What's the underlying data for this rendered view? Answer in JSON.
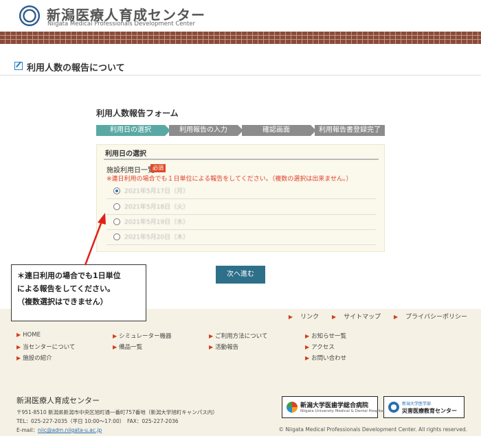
{
  "header": {
    "title": "新潟医療人育成センター",
    "subtitle": "Niigata Medical Professionals Development Center"
  },
  "page": {
    "title": "利用人数の報告について"
  },
  "form": {
    "heading": "利用人数報告フォーム",
    "steps": [
      {
        "label": "利用日の選択",
        "active": true
      },
      {
        "label": "利用報告の入力",
        "active": false
      },
      {
        "label": "確認画面",
        "active": false
      },
      {
        "label": "利用報告書登録完了",
        "active": false
      }
    ],
    "panel_heading": "利用日の選択",
    "field_label": "施設利用日一覧",
    "required_badge": "必須",
    "notice": "※連日利用の場合でも１日単位による報告をしてください。（複数の選択は出来ません。）",
    "options": [
      {
        "label": "2021年5月17日（月）",
        "checked": true
      },
      {
        "label": "2021年5月18日（火）",
        "checked": false
      },
      {
        "label": "2021年5月19日（水）",
        "checked": false
      },
      {
        "label": "2021年5月20日（木）",
        "checked": false
      }
    ],
    "next_button": "次へ進む"
  },
  "callout": {
    "lines": [
      "＊連日利用の場合でも1日単位",
      "による報告をしてください。",
      "（複数選択はできません）"
    ],
    "color": "#e0201a"
  },
  "footer": {
    "top_links": [
      "リンク",
      "サイトマップ",
      "プライバシーポリシー"
    ],
    "nav_columns": [
      [
        "HOME",
        "当センターについて",
        "施設の紹介"
      ],
      [
        "シミュレーター機器",
        "備品一覧"
      ],
      [
        "ご利用方法について",
        "活動報告"
      ],
      [
        "お知らせ一覧",
        "アクセス",
        "お問い合わせ"
      ]
    ],
    "org_name": "新潟医療人育成センター",
    "address": "〒951-8510 新潟県新潟市中央区旭町通一番町757番地（新潟大学旭町キャンパス内）",
    "tel": "TEL：025-227-2035（平日 10:00〜17:00）　FAX：025-227-2036",
    "email_label": "E-mail：",
    "email": "niic@adm.niigata-u.ac.jp",
    "banners": [
      {
        "title": "新潟大学医歯学総合病院",
        "sub": "Niigata University Medical & Dental Hospital"
      },
      {
        "title": "災害医療教育センター",
        "sub": "新潟大学医学部"
      }
    ],
    "copyright": "© Niigata Medical Professionals Development Center. All rights reserved."
  }
}
